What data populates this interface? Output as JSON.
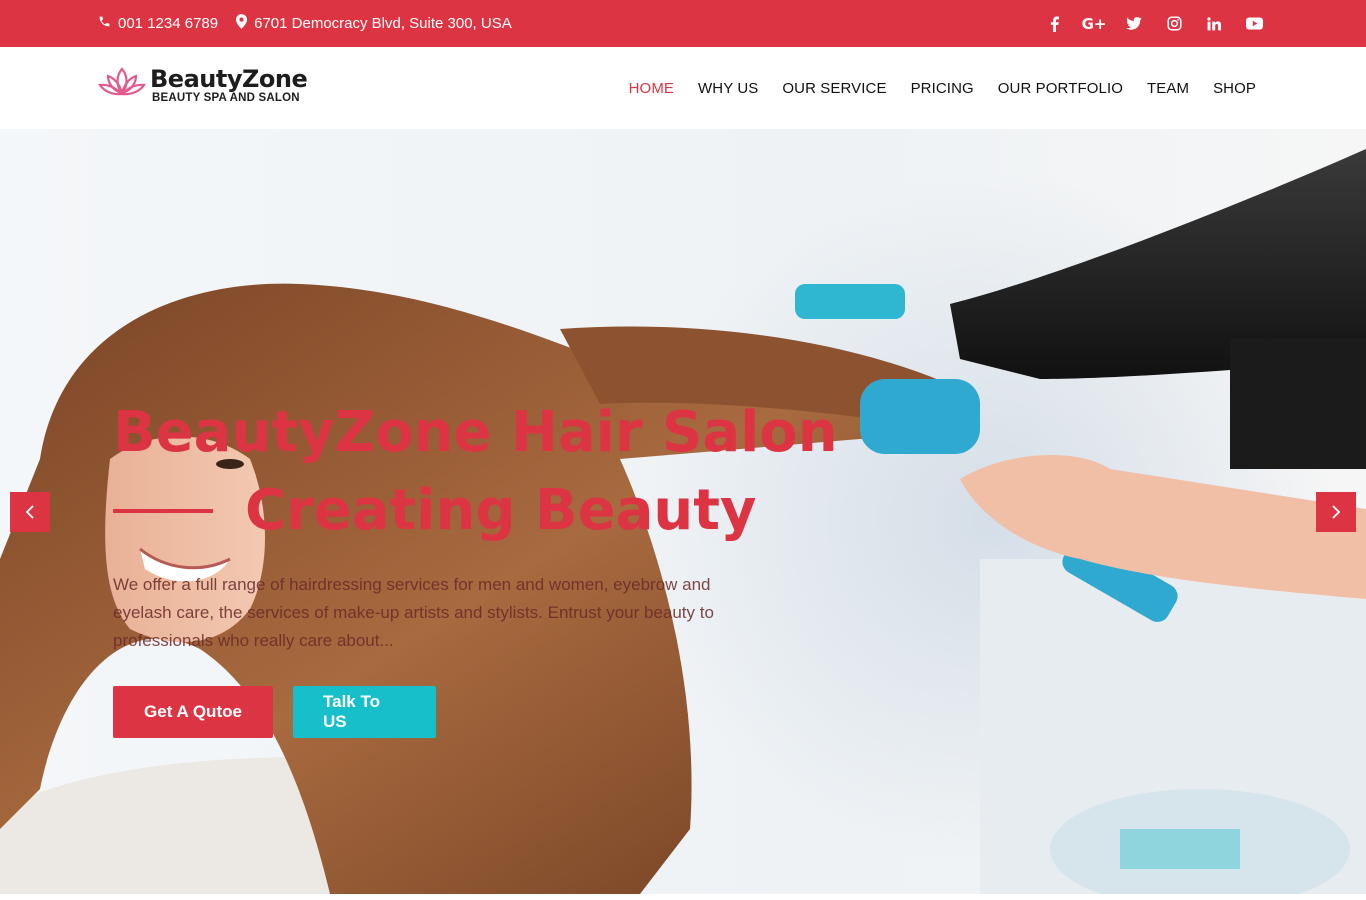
{
  "topbar": {
    "phone": "001 1234 6789",
    "address": "6701 Democracy Blvd, Suite 300, USA",
    "social": [
      "facebook-icon",
      "google-plus-icon",
      "twitter-icon",
      "instagram-icon",
      "linkedin-icon",
      "youtube-icon"
    ]
  },
  "header": {
    "brand": "BeautyZone",
    "tagline": "BEAUTY SPA AND SALON",
    "nav": [
      {
        "label": "HOME",
        "active": true
      },
      {
        "label": "WHY US"
      },
      {
        "label": "OUR SERVICE"
      },
      {
        "label": "PRICING"
      },
      {
        "label": "OUR PORTFOLIO"
      },
      {
        "label": "TEAM"
      },
      {
        "label": "SHOP"
      }
    ]
  },
  "hero": {
    "title_line1": "BeautyZone Hair Salon",
    "title_line2": "Creating Beauty",
    "description": "We offer a full range of hairdressing services for men and women, eyebrow and eyelash care, the services of make-up artists and stylists. Entrust your beauty to professionals who really care about...",
    "button_primary": "Get A Qutoe",
    "button_secondary": "Talk To US"
  },
  "colors": {
    "accent": "#dd3444",
    "secondary": "#17bfcb"
  }
}
